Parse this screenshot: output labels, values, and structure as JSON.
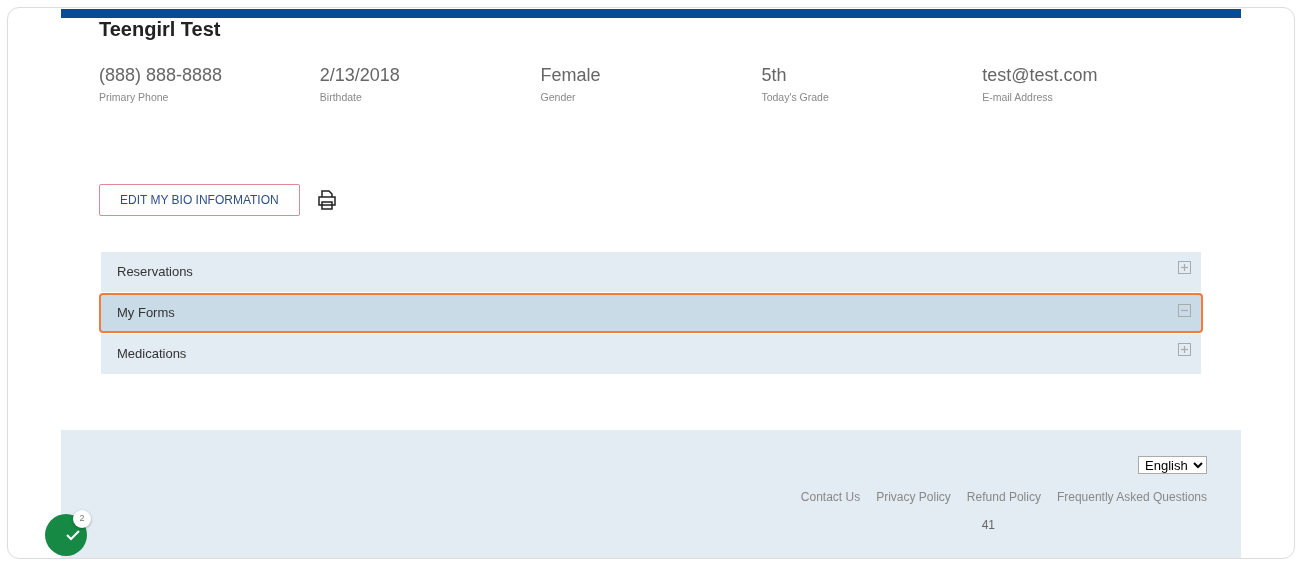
{
  "profile": {
    "name": "Teengirl Test",
    "fields": [
      {
        "value": "(888) 888-8888",
        "label": "Primary Phone"
      },
      {
        "value": "2/13/2018",
        "label": "Birthdate"
      },
      {
        "value": "Female",
        "label": "Gender"
      },
      {
        "value": "5th",
        "label": "Today's Grade"
      },
      {
        "value": "test@test.com",
        "label": "E-mail Address"
      }
    ]
  },
  "edit_button": "EDIT MY BIO INFORMATION",
  "accordion": [
    {
      "label": "Reservations",
      "expanded": false,
      "selected": false
    },
    {
      "label": "My Forms",
      "expanded": true,
      "selected": true
    },
    {
      "label": "Medications",
      "expanded": false,
      "selected": false
    }
  ],
  "footer": {
    "language": "English",
    "links": [
      "Contact Us",
      "Privacy Policy",
      "Refund Policy",
      "Frequently Asked Questions"
    ],
    "note": "41"
  },
  "notification_badge": {
    "count": "2"
  }
}
